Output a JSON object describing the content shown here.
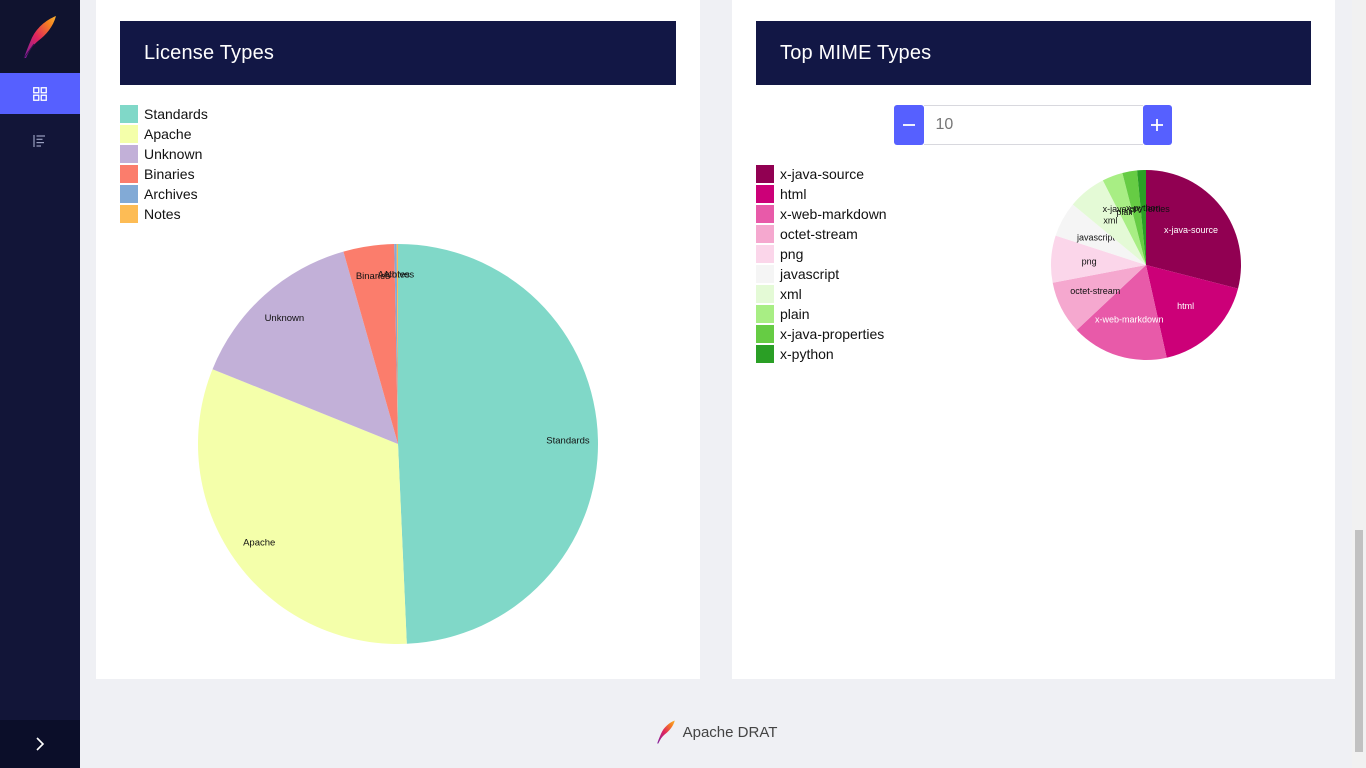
{
  "app": {
    "footer_label": "Apache DRAT"
  },
  "icons": {
    "logo": "apache-feather-icon",
    "dashboard": "grid-icon",
    "list": "list-icon",
    "expand": "chevron-right-icon"
  },
  "license_card": {
    "title": "License Types",
    "legend": [
      {
        "label": "Standards",
        "color": "#80d8c8"
      },
      {
        "label": "Apache",
        "color": "#f4ffaa"
      },
      {
        "label": "Unknown",
        "color": "#c2b0d8"
      },
      {
        "label": "Binaries",
        "color": "#fb7d6c"
      },
      {
        "label": "Archives",
        "color": "#82aad6"
      },
      {
        "label": "Notes",
        "color": "#fdbc55"
      }
    ]
  },
  "mime_card": {
    "title": "Top MIME Types",
    "stepper": {
      "value": "10",
      "minus_label": "−",
      "plus_label": "+"
    },
    "legend": [
      {
        "label": "x-java-source",
        "color": "#910052"
      },
      {
        "label": "html",
        "color": "#cc0078"
      },
      {
        "label": "x-web-markdown",
        "color": "#e85aa9"
      },
      {
        "label": "octet-stream",
        "color": "#f5a8cf"
      },
      {
        "label": "png",
        "color": "#fbd6ea"
      },
      {
        "label": "javascript",
        "color": "#f5f5f5"
      },
      {
        "label": "xml",
        "color": "#e4fad6"
      },
      {
        "label": "plain",
        "color": "#a8ee84"
      },
      {
        "label": "x-java-properties",
        "color": "#66cc44"
      },
      {
        "label": "x-python",
        "color": "#2a9f25"
      }
    ]
  },
  "chart_data": [
    {
      "type": "pie",
      "title": "License Types",
      "slices": [
        {
          "label": "Standards",
          "value": 49.3,
          "color": "#80d8c8"
        },
        {
          "label": "Apache",
          "value": 31.8,
          "color": "#f4ffaa"
        },
        {
          "label": "Unknown",
          "value": 14.5,
          "color": "#c2b0d8"
        },
        {
          "label": "Binaries",
          "value": 4.1,
          "color": "#fb7d6c"
        },
        {
          "label": "Archives",
          "value": 0.2,
          "color": "#82aad6"
        },
        {
          "label": "Notes",
          "value": 0.1,
          "color": "#fdbc55"
        }
      ]
    },
    {
      "type": "pie",
      "title": "Top MIME Types",
      "slices": [
        {
          "label": "x-java-source",
          "value": 29.0,
          "color": "#910052"
        },
        {
          "label": "html",
          "value": 17.5,
          "color": "#cc0078"
        },
        {
          "label": "x-web-markdown",
          "value": 16.5,
          "color": "#e85aa9"
        },
        {
          "label": "octet-stream",
          "value": 9.0,
          "color": "#f5a8cf"
        },
        {
          "label": "png",
          "value": 8.0,
          "color": "#fbd6ea"
        },
        {
          "label": "javascript",
          "value": 6.0,
          "color": "#f5f5f5"
        },
        {
          "label": "xml",
          "value": 6.5,
          "color": "#e4fad6"
        },
        {
          "label": "plain",
          "value": 3.5,
          "color": "#a8ee84"
        },
        {
          "label": "x-java-properties",
          "value": 2.5,
          "color": "#66cc44"
        },
        {
          "label": "x-python",
          "value": 1.5,
          "color": "#2a9f25"
        }
      ]
    }
  ]
}
